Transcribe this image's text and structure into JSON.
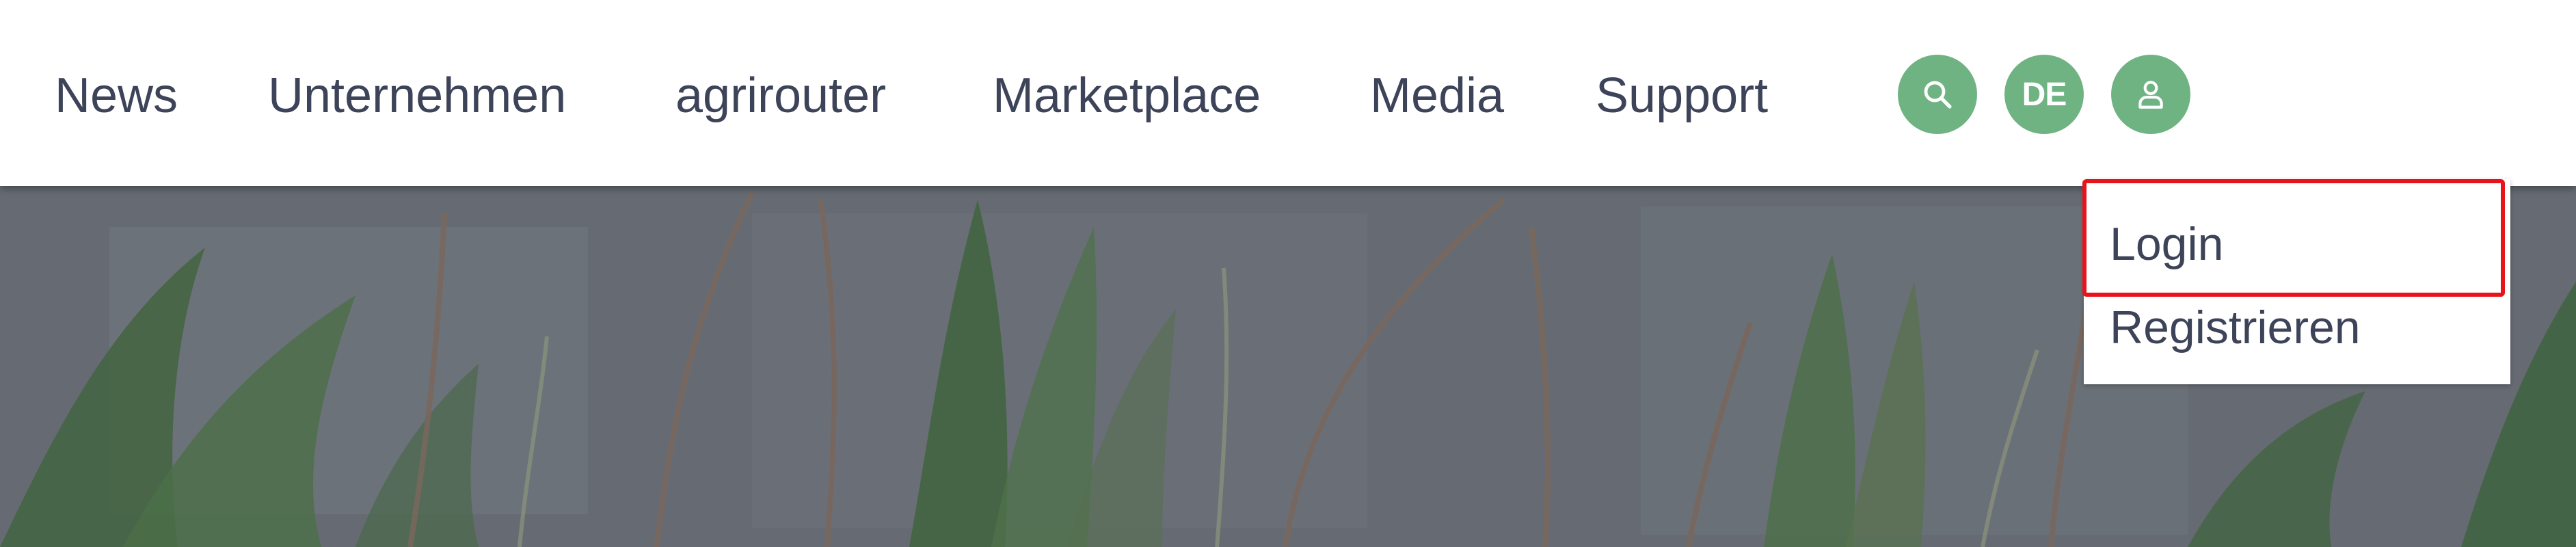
{
  "nav": {
    "items": [
      {
        "label": "News"
      },
      {
        "label": "Unternehmen"
      },
      {
        "label": "agrirouter"
      },
      {
        "label": "Marketplace"
      },
      {
        "label": "Media"
      },
      {
        "label": "Support"
      }
    ],
    "language_label": "DE",
    "icons": {
      "search": "search-icon",
      "user": "user-icon"
    },
    "accent_color": "#6fb383"
  },
  "user_menu": {
    "items": [
      {
        "label": "Login"
      },
      {
        "label": "Registrieren"
      }
    ],
    "highlight_color": "#e8141c"
  },
  "colors": {
    "nav_text": "#3d4358",
    "hero_overlay": "#6d737b"
  }
}
